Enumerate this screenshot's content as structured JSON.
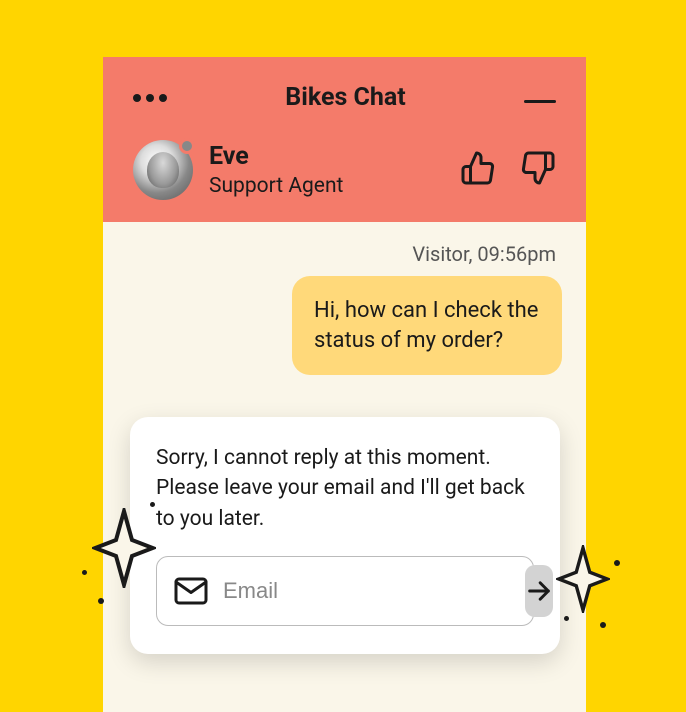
{
  "header": {
    "title": "Bikes Chat"
  },
  "agent": {
    "name": "Eve",
    "role": "Support Agent"
  },
  "message": {
    "meta": "Visitor, 09:56pm",
    "text": "Hi, how can I check the status of my order?"
  },
  "card": {
    "text": "Sorry, I cannot reply at this moment. Please leave your email and I'll get back to you later.",
    "email_placeholder": "Email"
  }
}
